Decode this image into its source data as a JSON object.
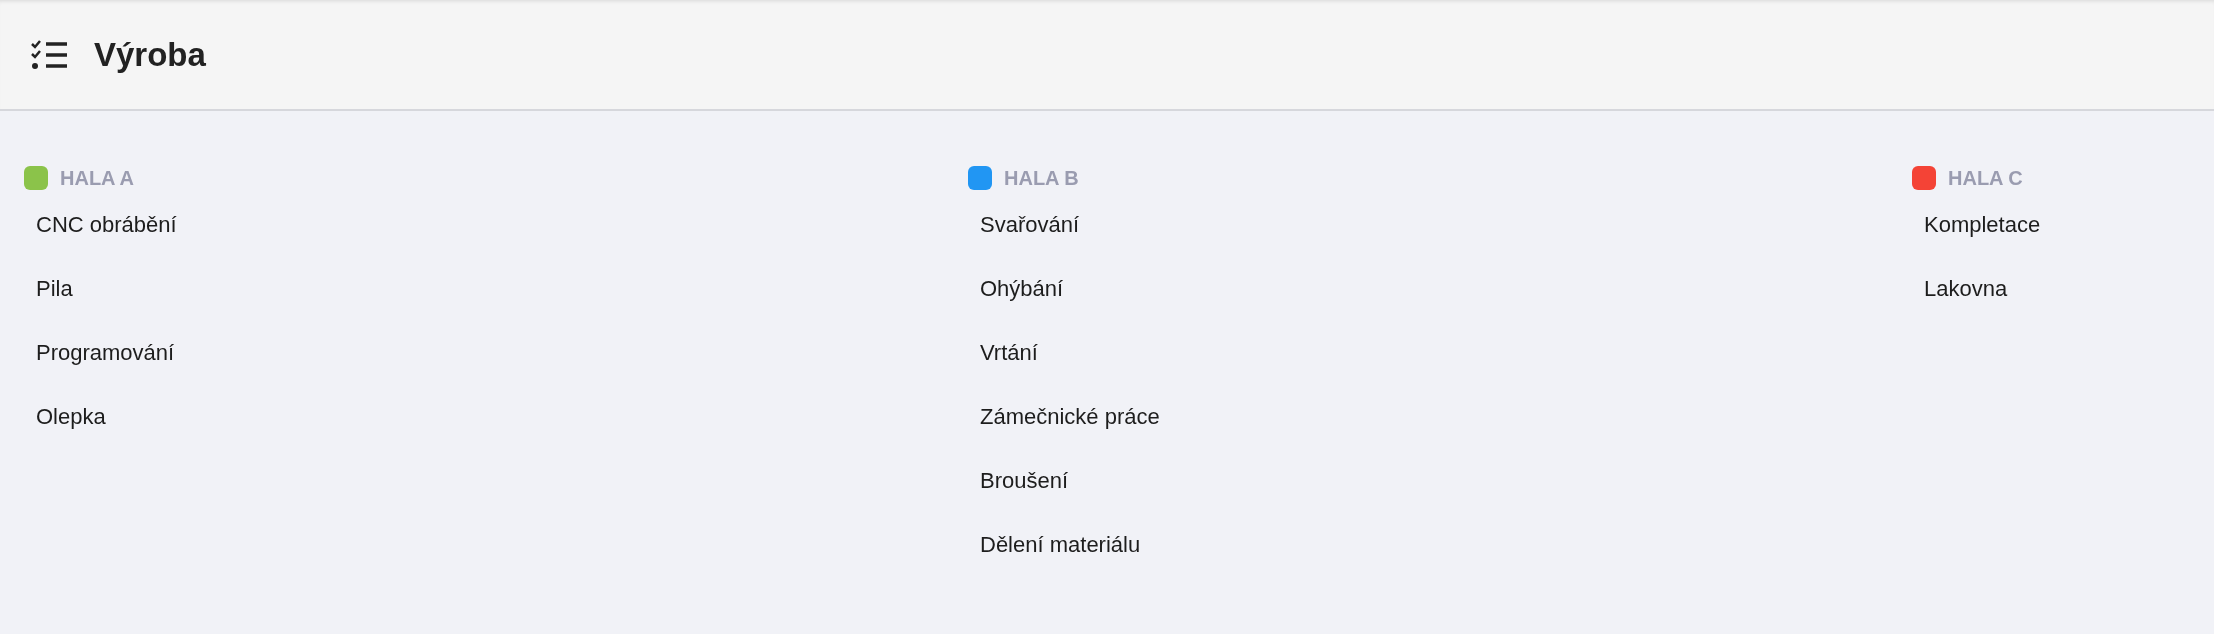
{
  "header": {
    "title": "Výroba"
  },
  "groups": [
    {
      "name": "HALA A",
      "color": "#8bc34a",
      "items": [
        "CNC obrábění",
        "Pila",
        "Programování",
        "Olepka"
      ]
    },
    {
      "name": "HALA B",
      "color": "#2196f3",
      "items": [
        "Svařování",
        "Ohýbání",
        "Vrtání",
        "Zámečnické práce",
        "Broušení",
        "Dělení materiálu"
      ]
    },
    {
      "name": "HALA C",
      "color": "#f44336",
      "items": [
        "Kompletace",
        "Lakovna"
      ]
    }
  ]
}
